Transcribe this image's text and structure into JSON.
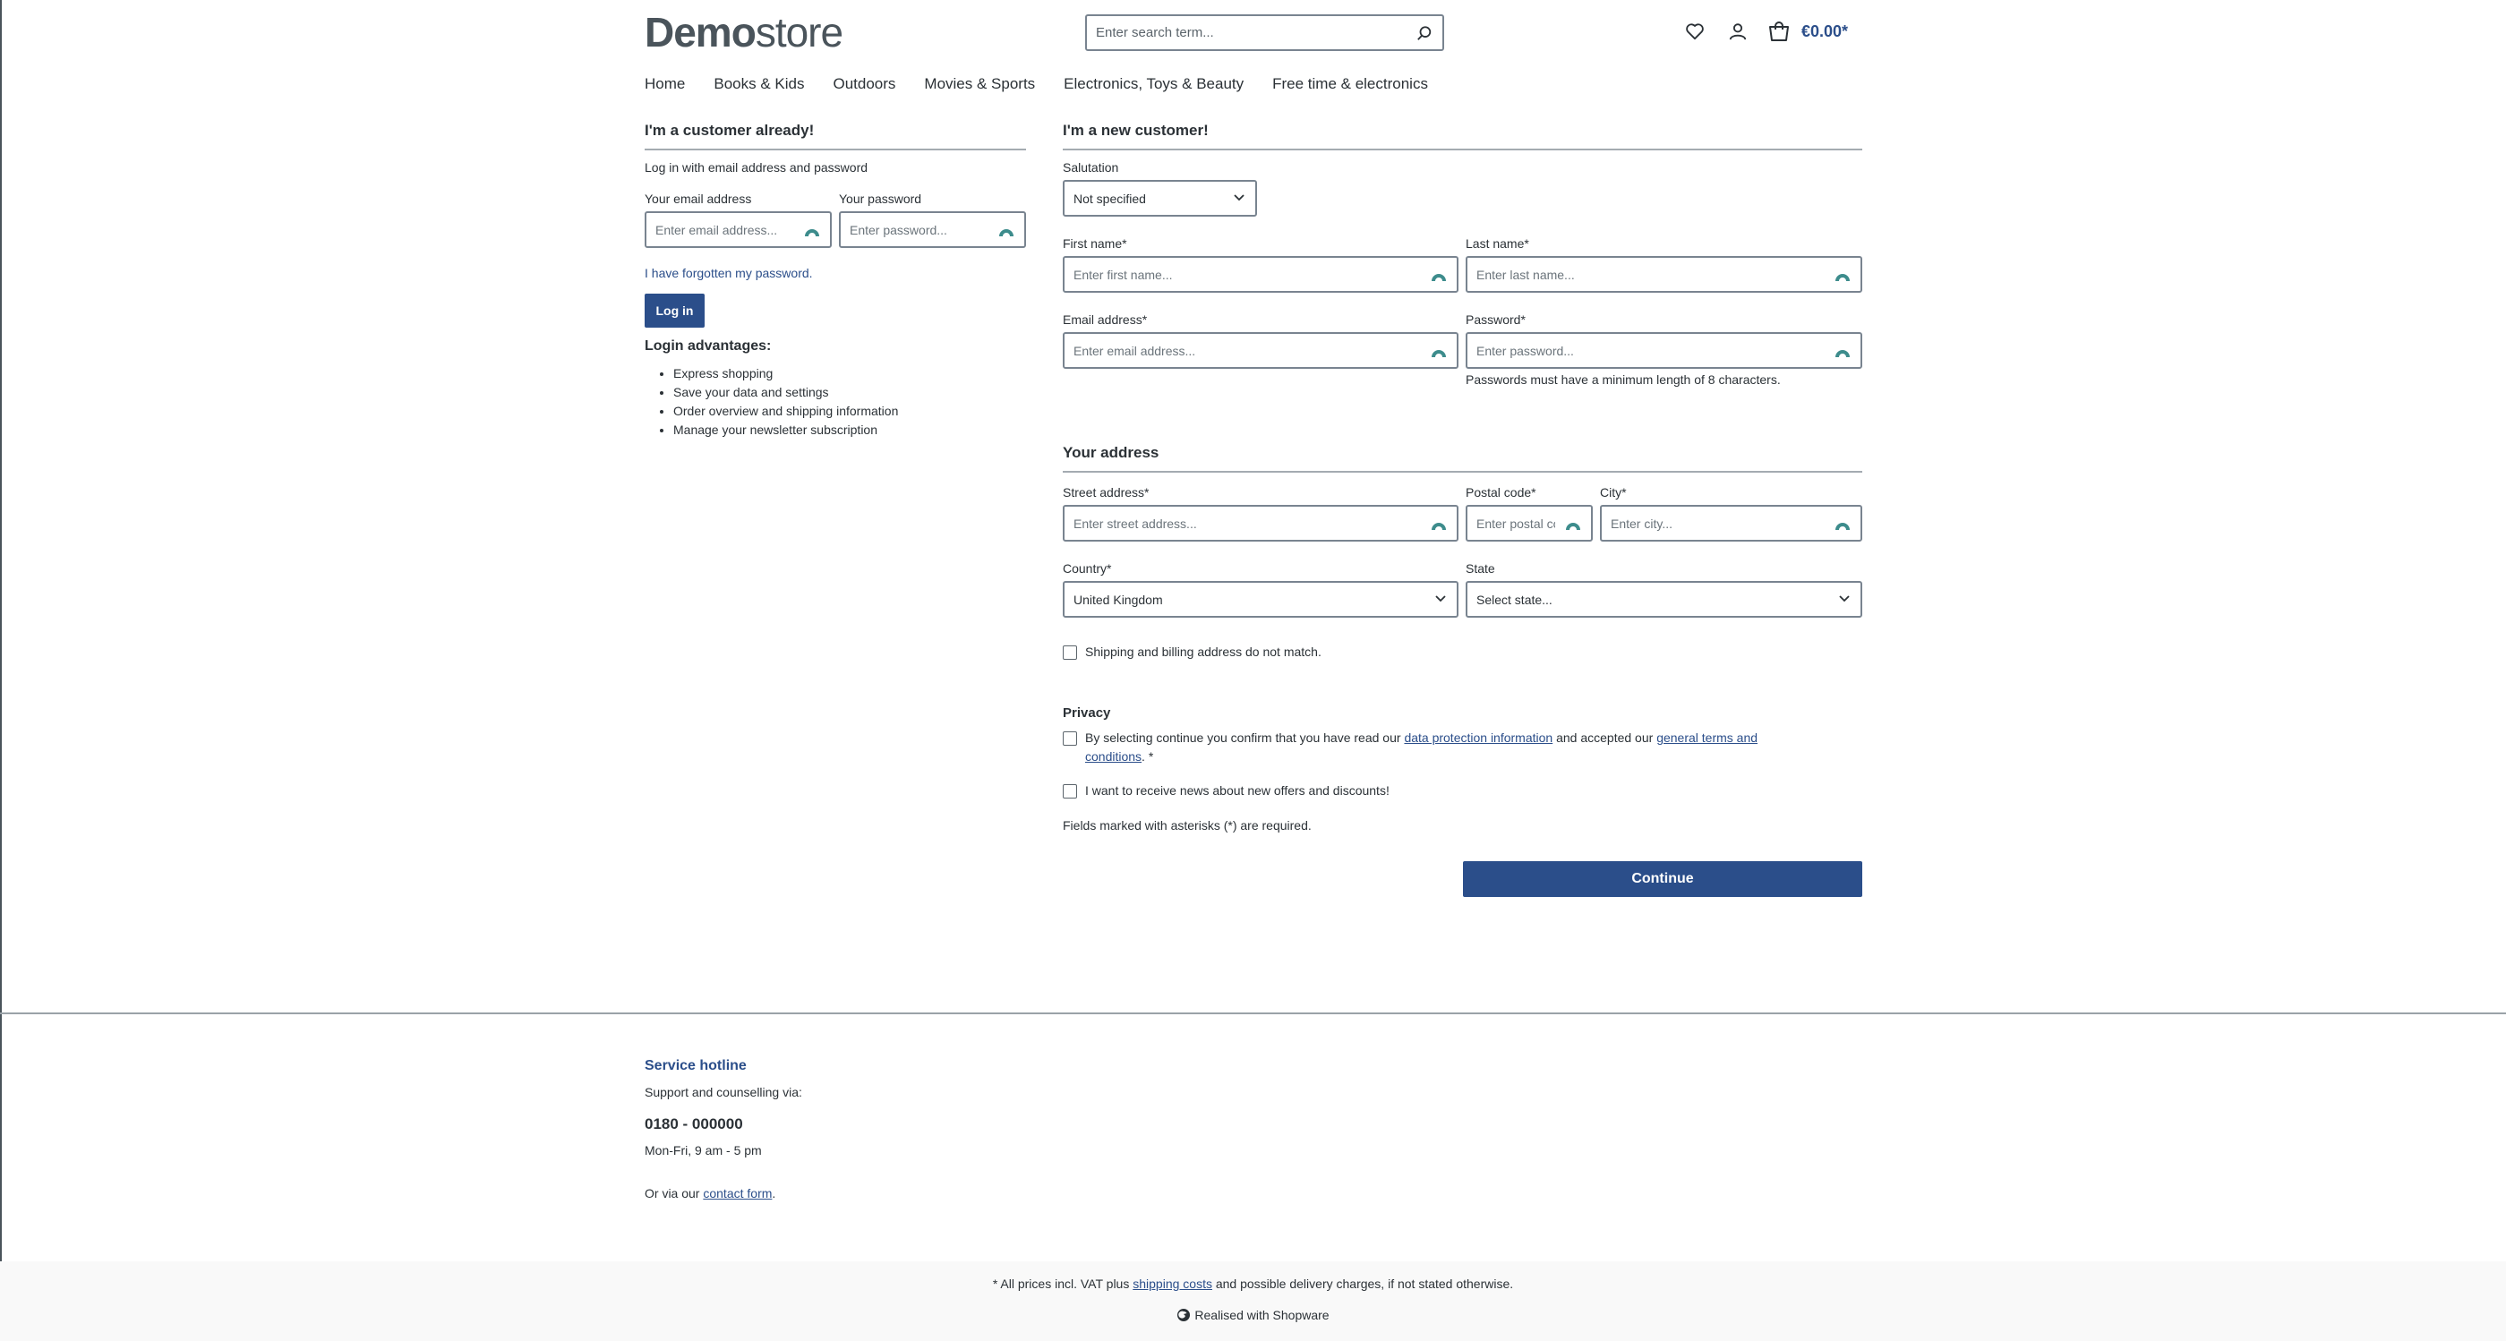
{
  "header": {
    "logo_bold": "Demo",
    "logo_light": "store",
    "search_placeholder": "Enter search term...",
    "cart_total": "€0.00*",
    "icons": [
      "heart-icon",
      "user-icon",
      "cart-icon",
      "search-icon"
    ]
  },
  "nav": [
    "Home",
    "Books & Kids",
    "Outdoors",
    "Movies & Sports",
    "Electronics, Toys & Beauty",
    "Free time & electronics"
  ],
  "login": {
    "title": "I'm a customer already!",
    "intro": "Log in with email address and password",
    "email_label": "Your email address",
    "email_placeholder": "Enter email address...",
    "password_label": "Your password",
    "password_placeholder": "Enter password...",
    "forgot_link": "I have forgotten my password.",
    "login_button": "Log in",
    "advantages_title": "Login advantages:",
    "advantages": [
      "Express shopping",
      "Save your data and settings",
      "Order overview and shipping information",
      "Manage your newsletter subscription"
    ]
  },
  "register": {
    "title": "I'm a new customer!",
    "salutation_label": "Salutation",
    "salutation_value": "Not specified",
    "first_name_label": "First name*",
    "first_name_placeholder": "Enter first name...",
    "last_name_label": "Last name*",
    "last_name_placeholder": "Enter last name...",
    "email_label": "Email address*",
    "email_placeholder": "Enter email address...",
    "password_label": "Password*",
    "password_placeholder": "Enter password...",
    "password_hint": "Passwords must have a minimum length of 8 characters.",
    "address_title": "Your address",
    "street_label": "Street address*",
    "street_placeholder": "Enter street address...",
    "postal_label": "Postal code*",
    "postal_placeholder": "Enter postal code...",
    "city_label": "City*",
    "city_placeholder": "Enter city...",
    "country_label": "Country*",
    "country_value": "United Kingdom",
    "state_label": "State",
    "state_value": "Select state...",
    "different_address": "Shipping and billing address do not match.",
    "privacy_title": "Privacy",
    "privacy_text_1": "By selecting continue you confirm that you have read our ",
    "privacy_link_1": "data protection information",
    "privacy_text_2": " and accepted our ",
    "privacy_link_2": "general terms and conditions",
    "privacy_text_3": ". *",
    "newsletter": "I want to receive news about new offers and discounts!",
    "required_note": "Fields marked with asterisks (*) are required.",
    "continue_button": "Continue"
  },
  "footer": {
    "hotline_title": "Service hotline",
    "hotline_sub": "Support and counselling via:",
    "phone": "0180 - 000000",
    "hours": "Mon-Fri, 9 am - 5 pm",
    "contact_prefix": "Or via our ",
    "contact_link": "contact form",
    "contact_suffix": ".",
    "vat_prefix": "* All prices incl. VAT plus ",
    "vat_link": "shipping costs",
    "vat_suffix": " and possible delivery charges, if not stated otherwise.",
    "realised": "Realised with Shopware"
  },
  "colors": {
    "primary": "#2b4e8a",
    "text": "#2b3136",
    "border": "#798490"
  }
}
